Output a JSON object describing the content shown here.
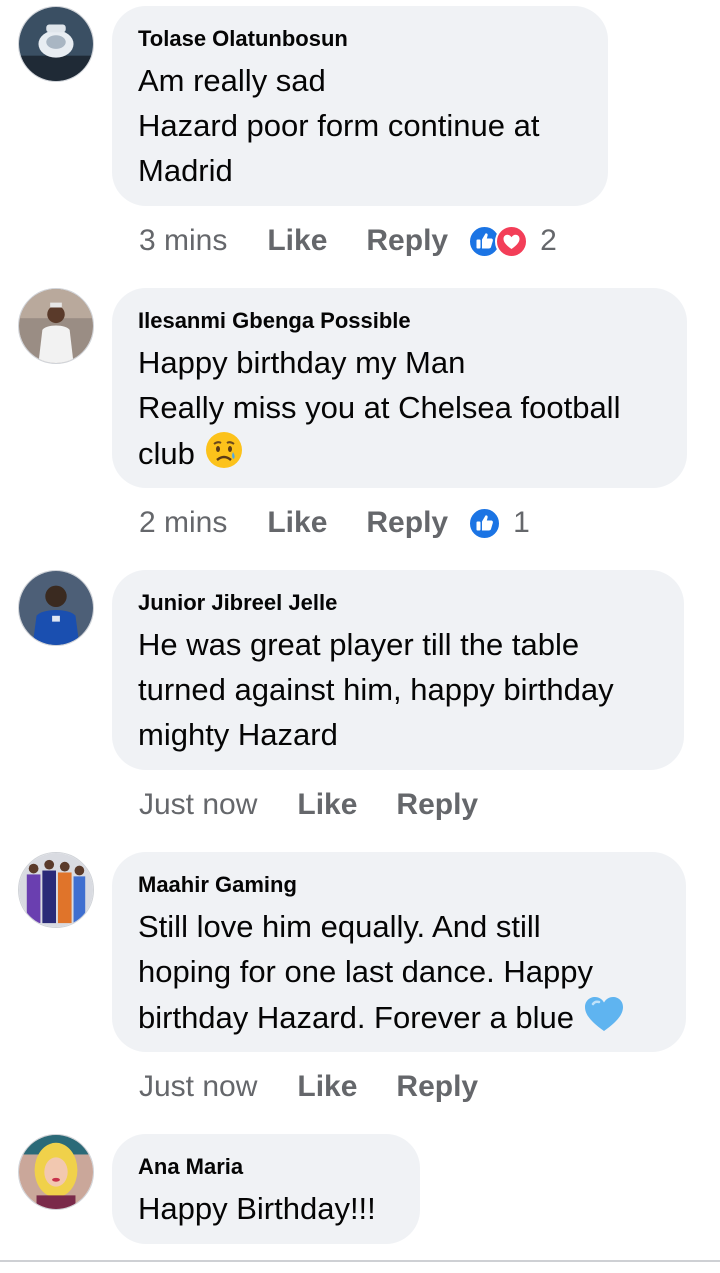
{
  "comments": [
    {
      "author": "Tolase Olatunbosun",
      "text": "Am really sad\nHazard poor form continue at\nMadrid",
      "time": "3 mins",
      "like_label": "Like",
      "reply_label": "Reply",
      "reactions": [
        "like-icon",
        "love-icon"
      ],
      "reaction_count": "2"
    },
    {
      "author": "Ilesanmi Gbenga Possible",
      "text_lines": [
        "Happy birthday my Man",
        "Really miss you at Chelsea football",
        "club"
      ],
      "emoji": "sad-relieved-face-emoji",
      "time": "2 mins",
      "like_label": "Like",
      "reply_label": "Reply",
      "reactions": [
        "like-icon"
      ],
      "reaction_count": "1"
    },
    {
      "author": "Junior Jibreel Jelle",
      "text": "He was great player till the table\nturned against him, happy birthday\nmighty Hazard",
      "time": "Just now",
      "like_label": "Like",
      "reply_label": "Reply"
    },
    {
      "author": "Maahir Gaming",
      "text_lines": [
        "Still love him equally. And still",
        "hoping for one last dance. Happy",
        "birthday Hazard. Forever a blue"
      ],
      "emoji": "blue-heart-emoji",
      "time": "Just now",
      "like_label": "Like",
      "reply_label": "Reply"
    },
    {
      "author": "Ana Maria",
      "text": "Happy Birthday!!!"
    }
  ],
  "colors": {
    "bubble": "#f0f2f5",
    "meta_text": "#65676b",
    "like_blue": "#1b74e4",
    "love_red": "#f33e58",
    "heart_blue": "#5fb4f0"
  }
}
